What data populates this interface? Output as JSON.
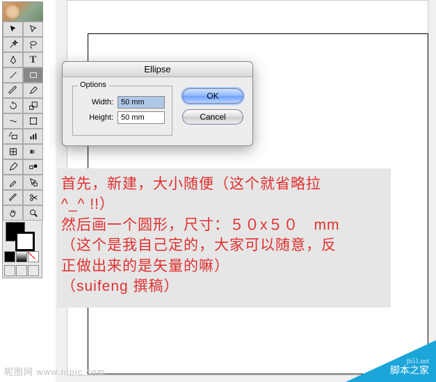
{
  "dialog": {
    "title": "Ellipse",
    "options_label": "Options",
    "width_label": "Width:",
    "width_value": "50 mm",
    "height_label": "Height:",
    "height_value": "50 mm",
    "ok": "OK",
    "cancel": "Cancel"
  },
  "annotation": {
    "line1": "首先，新建，大小随便（这个就省略拉",
    "line2": "^_^ !!）",
    "line3": "然后画一个圆形，尺寸：５０x５０　mm",
    "line4": "（这个是我自己定的，大家可以随意，反",
    "line5": "正做出来的是矢量的嘛）",
    "line6": "（suifeng 撰稿）"
  },
  "watermarks": {
    "left": "昵图网 www.nipic.com",
    "right_sub": "jb51.net",
    "right_main": "脚本之家"
  },
  "tools": [
    "selection",
    "direct-selection",
    "magic-wand",
    "lasso",
    "pen",
    "type",
    "line",
    "rectangle",
    "paintbrush",
    "pencil",
    "rotate",
    "scale",
    "warp",
    "free-transform",
    "symbol-sprayer",
    "graph",
    "mesh",
    "gradient",
    "eyedropper",
    "blend",
    "live-paint",
    "live-paint-select",
    "slice",
    "scissors",
    "hand",
    "zoom"
  ]
}
